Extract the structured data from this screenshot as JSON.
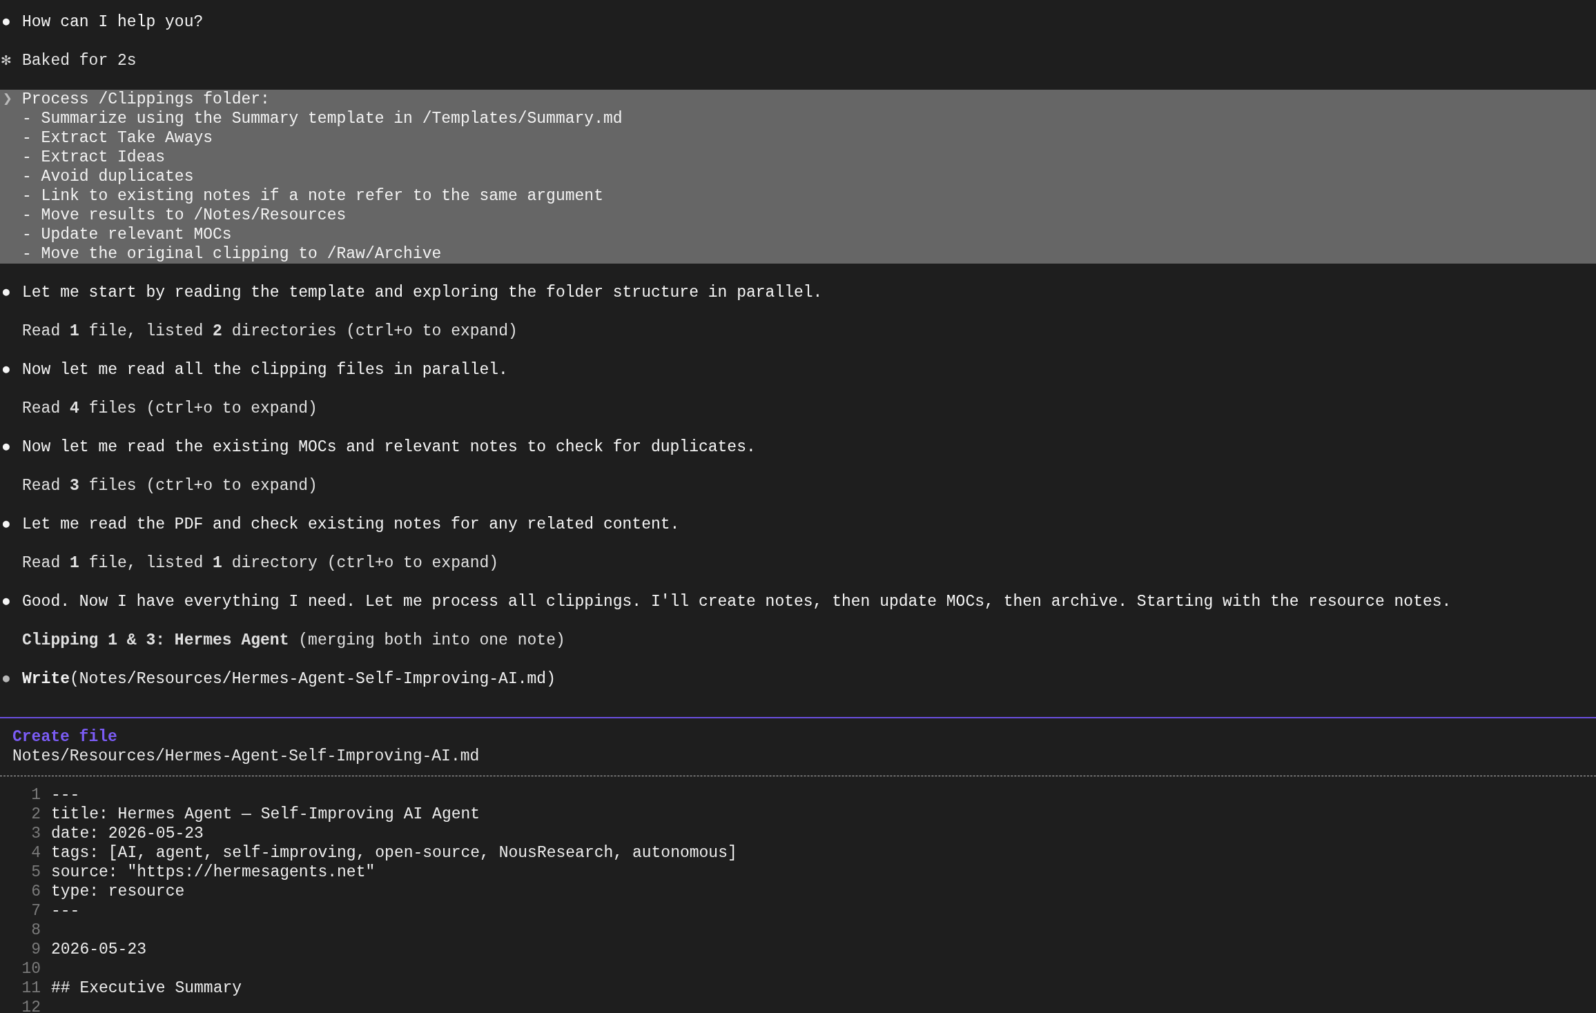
{
  "messages": [
    {
      "kind": "reply",
      "marker": "●",
      "text": "How can I help you?"
    },
    {
      "kind": "status",
      "marker": "✻",
      "text": "Baked for 2s"
    },
    {
      "kind": "prompt",
      "marker": "❯",
      "lines": [
        "Process /Clippings folder:",
        "- Summarize using the Summary template in /Templates/Summary.md",
        "- Extract Take Aways",
        "- Extract Ideas",
        "- Avoid duplicates",
        "- Link to existing notes if a note refer to the same argument",
        "- Move results to /Notes/Resources",
        "- Update relevant MOCs",
        "- Move the original clipping to /Raw/Archive"
      ]
    },
    {
      "kind": "reply",
      "marker": "●",
      "text": "Let me start by reading the template and exploring the folder structure in parallel."
    },
    {
      "kind": "summary",
      "text": "Read **1** file, listed **2** directories (ctrl+o to expand)"
    },
    {
      "kind": "reply",
      "marker": "●",
      "text": "Now let me read all the clipping files in parallel."
    },
    {
      "kind": "summary",
      "text": "Read **4** files (ctrl+o to expand)"
    },
    {
      "kind": "reply",
      "marker": "●",
      "text": "Now let me read the existing MOCs and relevant notes to check for duplicates."
    },
    {
      "kind": "summary",
      "text": "Read **3** files (ctrl+o to expand)"
    },
    {
      "kind": "reply",
      "marker": "●",
      "text": "Let me read the PDF and check existing notes for any related content."
    },
    {
      "kind": "summary",
      "text": "Read **1** file, listed **1** directory (ctrl+o to expand)"
    },
    {
      "kind": "reply",
      "marker": "●",
      "text": "Good. Now I have everything I need. Let me process all clippings. I'll create notes, then update MOCs, then archive. Starting with the resource notes."
    },
    {
      "kind": "summary",
      "text": "**Clipping 1 & 3: Hermes Agent** (merging both into one note)"
    },
    {
      "kind": "tool",
      "marker": "●",
      "text": "**Write**(Notes/Resources/Hermes-Agent-Self-Improving-AI.md)"
    }
  ],
  "file_panel": {
    "action": "Create file",
    "path": "Notes/Resources/Hermes-Agent-Self-Improving-AI.md",
    "lines": [
      {
        "number": "1",
        "text": "---"
      },
      {
        "number": "2",
        "text": "title: Hermes Agent — Self-Improving AI Agent"
      },
      {
        "number": "3",
        "text": "date: 2026-05-23"
      },
      {
        "number": "4",
        "text": "tags: [AI, agent, self-improving, open-source, NousResearch, autonomous]"
      },
      {
        "number": "5",
        "text": "source: \"https://hermesagents.net\""
      },
      {
        "number": "6",
        "text": "type: resource"
      },
      {
        "number": "7",
        "text": "---"
      },
      {
        "number": "8"
      },
      {
        "number": "9",
        "text": "2026-05-23"
      },
      {
        "number": "10"
      },
      {
        "number": "11",
        "text": "## Executive Summary"
      },
      {
        "number": "12"
      }
    ]
  }
}
